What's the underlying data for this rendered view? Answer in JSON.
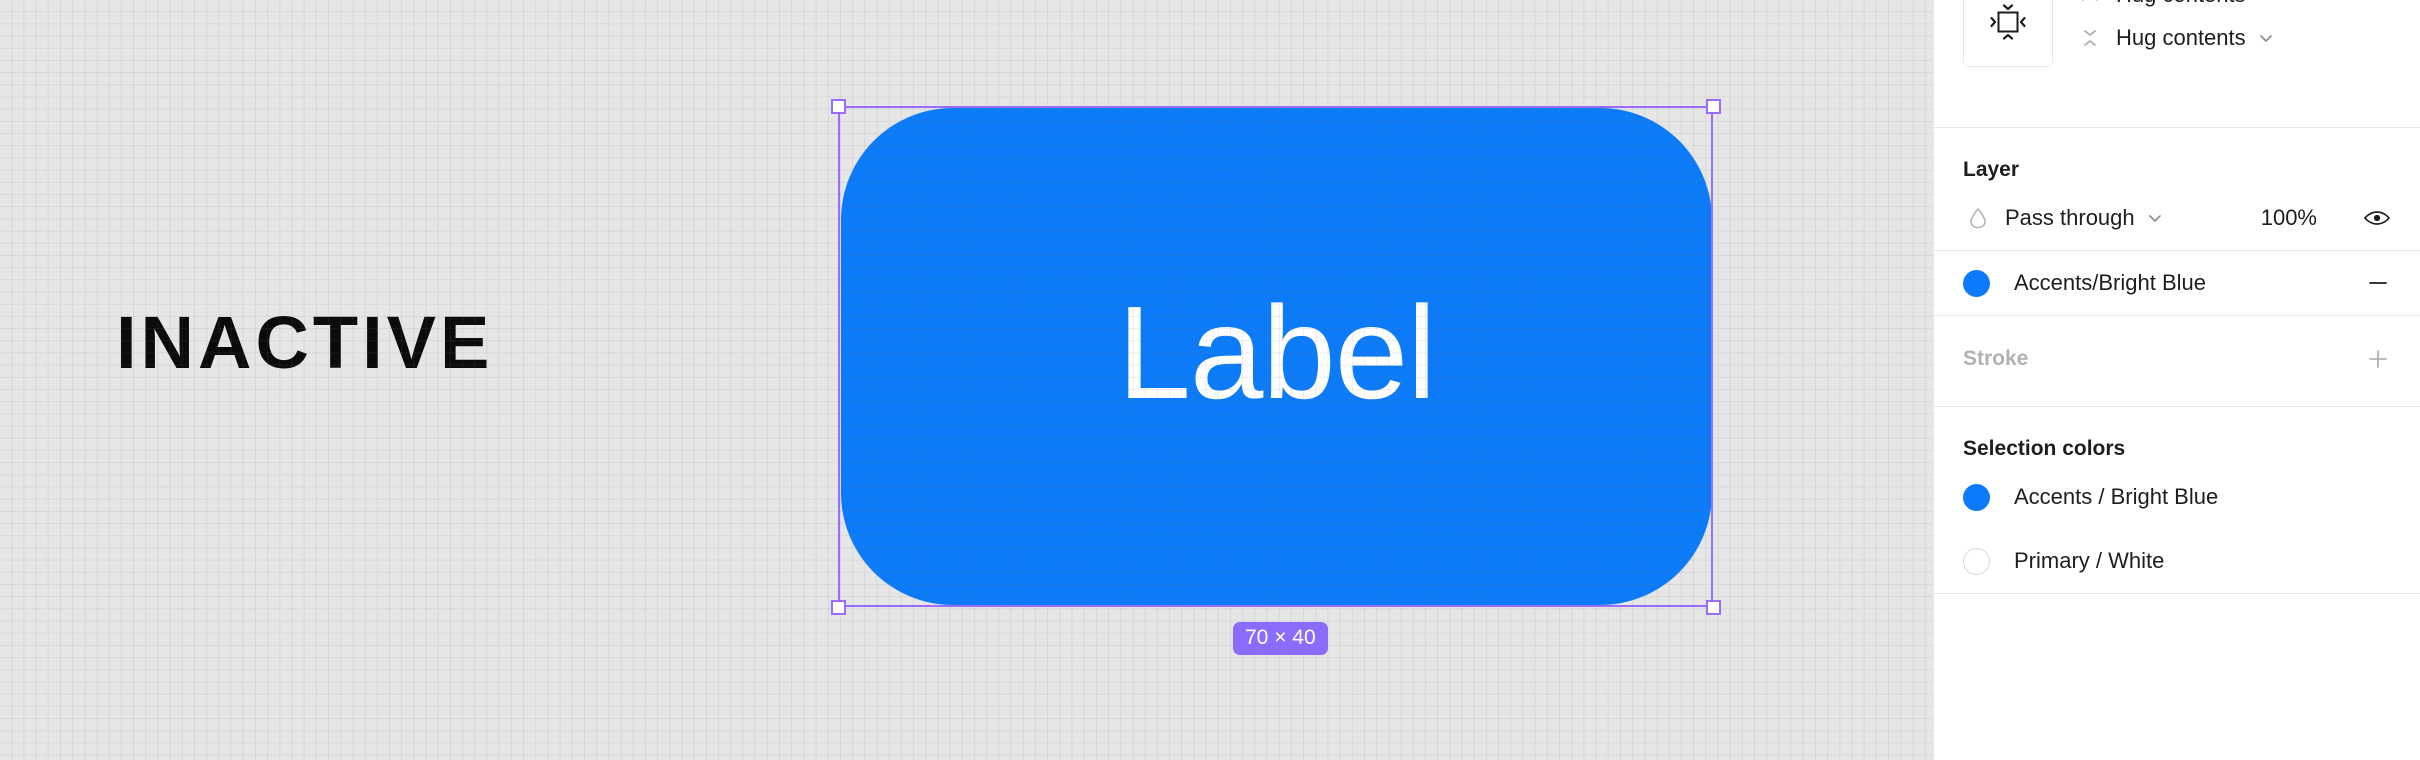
{
  "canvas": {
    "inactive_label": "INACTIVE",
    "button": {
      "label": "Label",
      "fill_color": "#0b7bfa",
      "text_color": "#ffffff"
    },
    "selection": {
      "size_badge": "70 × 40",
      "badge_color": "#8b6bfb",
      "outline_color": "#9b6dff"
    },
    "background_color": "#e6e6e6"
  },
  "panel": {
    "resize": {
      "constraints_icon": "resize-constraints-icon",
      "horizontal": {
        "icon": "horizontal-resizing-icon",
        "value": "Hug contents",
        "chevron": "chevron-down-icon"
      },
      "vertical": {
        "icon": "vertical-resizing-icon",
        "value": "Hug contents",
        "chevron": "chevron-down-icon"
      }
    },
    "layer": {
      "title": "Layer",
      "blend_icon": "blend-mode-icon",
      "blend_mode": "Pass through",
      "blend_chevron": "chevron-down-icon",
      "opacity": "100%",
      "visibility_icon": "eye-icon"
    },
    "fill": {
      "swatch_color": "#0d7bf9",
      "name": "Accents/Bright Blue",
      "remove_icon": "minus-icon"
    },
    "stroke": {
      "title": "Stroke",
      "add_icon": "plus-icon"
    },
    "selection_colors": {
      "title": "Selection colors",
      "items": [
        {
          "swatch": "#0d7bf9",
          "name": "Accents / Bright Blue",
          "kind": "blue"
        },
        {
          "swatch": "#ffffff",
          "name": "Primary / White",
          "kind": "white"
        }
      ]
    }
  }
}
